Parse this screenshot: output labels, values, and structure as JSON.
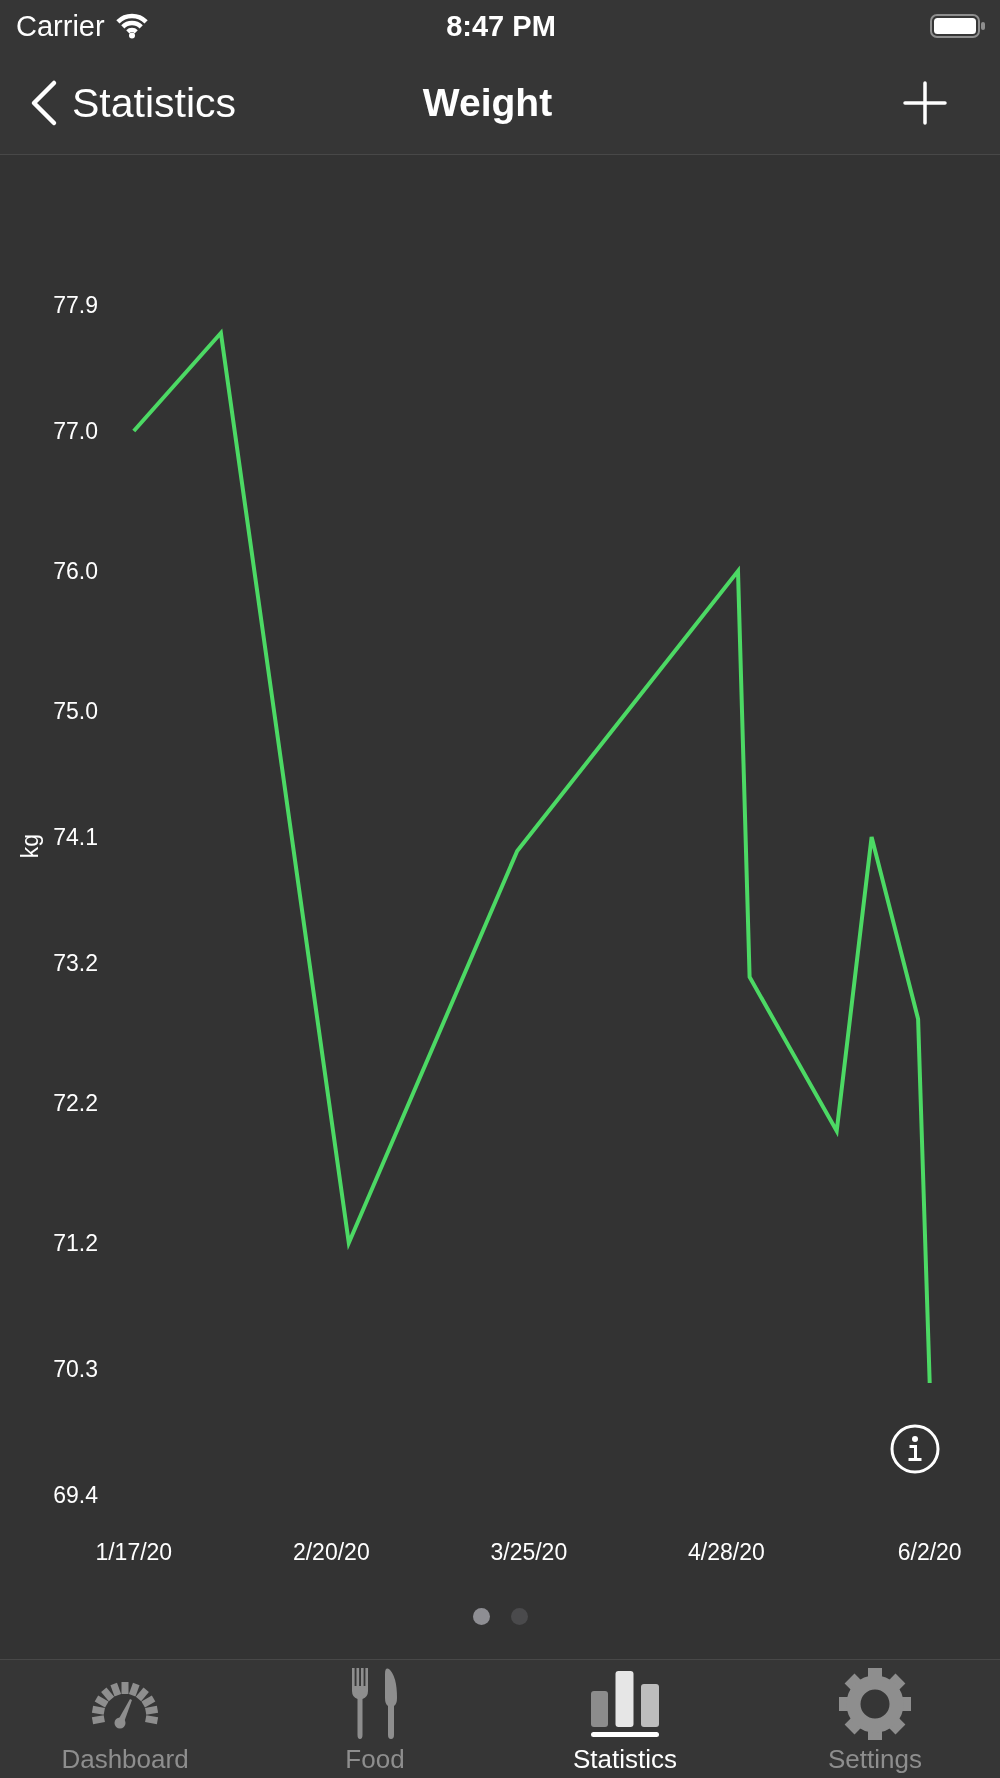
{
  "status_bar": {
    "carrier": "Carrier",
    "time": "8:47 PM"
  },
  "nav_bar": {
    "back_label": "Statistics",
    "title": "Weight"
  },
  "chart": {
    "chart_data": {
      "type": "line",
      "ylabel": "kg",
      "categories": [
        "1/17/20",
        null,
        null,
        null,
        null,
        null,
        null,
        null,
        null,
        null,
        null,
        null,
        null,
        null,
        null,
        null,
        null,
        null,
        null,
        null,
        null,
        null,
        null,
        null,
        null,
        null,
        null,
        null,
        null,
        null,
        null,
        null,
        null,
        null,
        "2/20/20",
        null,
        null,
        null,
        null,
        null,
        null,
        null,
        null,
        null,
        null,
        null,
        null,
        null,
        null,
        null,
        null,
        null,
        null,
        null,
        null,
        null,
        null,
        null,
        null,
        null,
        null,
        null,
        null,
        null,
        null,
        null,
        null,
        null,
        "3/25/20",
        null,
        null,
        null,
        null,
        null,
        null,
        null,
        null,
        null,
        null,
        null,
        null,
        null,
        null,
        null,
        null,
        null,
        null,
        null,
        null,
        null,
        null,
        null,
        null,
        null,
        null,
        null,
        null,
        null,
        null,
        null,
        null,
        null,
        "4/28/20",
        null,
        null,
        null,
        null,
        null,
        null,
        null,
        null,
        null,
        null,
        null,
        null,
        null,
        null,
        null,
        null,
        null,
        null,
        null,
        null,
        null,
        null,
        null,
        null,
        null,
        null,
        null,
        null,
        null,
        null,
        null,
        null,
        null,
        null,
        "6/2/20"
      ],
      "series": [
        {
          "color": "#4cd964",
          "values": [
            77.0,
            null,
            null,
            null,
            null,
            null,
            null,
            null,
            null,
            null,
            null,
            null,
            null,
            null,
            null,
            77.7,
            null,
            null,
            null,
            null,
            null,
            null,
            null,
            null,
            null,
            null,
            null,
            null,
            null,
            null,
            null,
            null,
            null,
            null,
            null,
            null,
            null,
            71.2,
            null,
            null,
            null,
            null,
            null,
            null,
            null,
            null,
            null,
            null,
            null,
            null,
            null,
            null,
            null,
            null,
            null,
            null,
            null,
            null,
            null,
            null,
            null,
            null,
            null,
            null,
            null,
            null,
            74.0,
            null,
            null,
            null,
            null,
            null,
            null,
            null,
            null,
            null,
            null,
            null,
            null,
            null,
            null,
            null,
            null,
            null,
            null,
            null,
            null,
            null,
            null,
            null,
            null,
            null,
            null,
            null,
            null,
            null,
            null,
            null,
            null,
            null,
            null,
            null,
            null,
            null,
            76.0,
            null,
            73.1,
            null,
            null,
            null,
            null,
            null,
            null,
            null,
            null,
            null,
            null,
            null,
            null,
            null,
            null,
            72.0,
            null,
            null,
            null,
            null,
            null,
            74.1,
            null,
            null,
            null,
            null,
            null,
            null,
            null,
            72.8,
            null,
            70.2
          ]
        }
      ],
      "ylim": [
        69.4,
        77.9
      ],
      "yticks": [
        {
          "value": 77.9,
          "label": "77.9"
        },
        {
          "value": 77.0,
          "label": "77.0"
        },
        {
          "value": 76.0,
          "label": "76.0"
        },
        {
          "value": 75.0,
          "label": "75.0"
        },
        {
          "value": 74.1,
          "label": "74.1"
        },
        {
          "value": 73.2,
          "label": "73.2"
        },
        {
          "value": 72.2,
          "label": "72.2"
        },
        {
          "value": 71.2,
          "label": "71.2"
        },
        {
          "value": 70.3,
          "label": "70.3"
        },
        {
          "value": 69.4,
          "label": "69.4"
        }
      ]
    }
  },
  "page_dots": [
    {
      "selected": true
    },
    {
      "selected": false
    }
  ],
  "tab_bar": {
    "tabs": [
      {
        "label": "Dashboard",
        "selected": false
      },
      {
        "label": "Food",
        "selected": false
      },
      {
        "label": "Statistics",
        "selected": true
      },
      {
        "label": "Settings",
        "selected": false
      }
    ]
  }
}
